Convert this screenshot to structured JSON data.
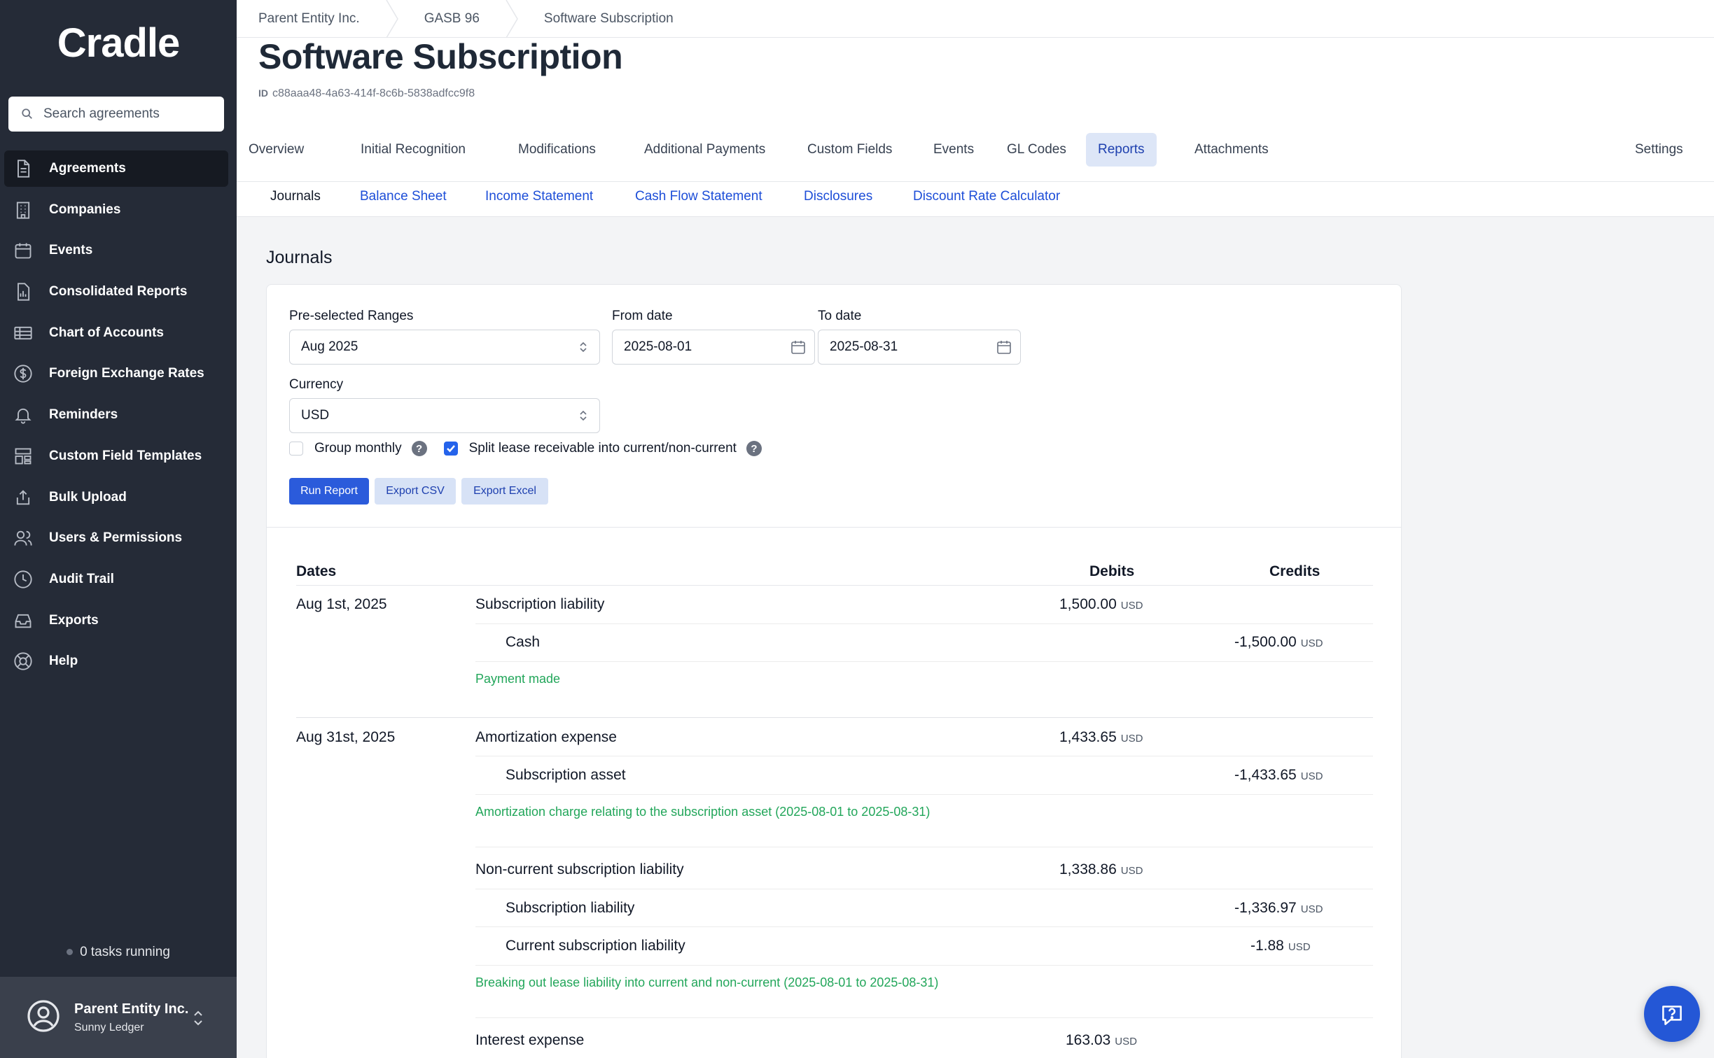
{
  "app": {
    "logo": "Cradle"
  },
  "sidebar": {
    "search_placeholder": "Search agreements",
    "items": [
      {
        "label": "Agreements",
        "icon": "document-icon",
        "active": true
      },
      {
        "label": "Companies",
        "icon": "building-icon"
      },
      {
        "label": "Events",
        "icon": "calendar-icon"
      },
      {
        "label": "Consolidated Reports",
        "icon": "report-icon"
      },
      {
        "label": "Chart of Accounts",
        "icon": "table-icon"
      },
      {
        "label": "Foreign Exchange Rates",
        "icon": "dollar-circle-icon"
      },
      {
        "label": "Reminders",
        "icon": "bell-icon"
      },
      {
        "label": "Custom Field Templates",
        "icon": "template-icon"
      },
      {
        "label": "Bulk Upload",
        "icon": "upload-icon"
      },
      {
        "label": "Users & Permissions",
        "icon": "users-icon"
      },
      {
        "label": "Audit Trail",
        "icon": "clock-icon"
      },
      {
        "label": "Exports",
        "icon": "tray-icon"
      },
      {
        "label": "Help",
        "icon": "lifebuoy-icon"
      }
    ],
    "tasks_status": "0 tasks running",
    "account": {
      "name": "Parent Entity Inc.",
      "subtitle": "Sunny Ledger"
    }
  },
  "breadcrumb": [
    "Parent Entity Inc.",
    "GASB 96",
    "Software Subscription"
  ],
  "page": {
    "title": "Software Subscription",
    "id_label": "ID",
    "id_value": "c88aaa48-4a63-414f-8c6b-5838adfcc9f8"
  },
  "tabs": [
    "Overview",
    "Initial Recognition",
    "Modifications",
    "Additional Payments",
    "Custom Fields",
    "Events",
    "GL Codes",
    "Reports",
    "Attachments"
  ],
  "active_tab": "Reports",
  "settings_label": "Settings",
  "subtabs": [
    "Journals",
    "Balance Sheet",
    "Income Statement",
    "Cash Flow Statement",
    "Disclosures",
    "Discount Rate Calculator"
  ],
  "active_subtab": "Journals",
  "section_title": "Journals",
  "form": {
    "range_label": "Pre-selected Ranges",
    "range_value": "Aug 2025",
    "from_label": "From date",
    "from_value": "2025-08-01",
    "to_label": "To date",
    "to_value": "2025-08-31",
    "currency_label": "Currency",
    "currency_value": "USD",
    "group_monthly_label": "Group monthly",
    "group_monthly_checked": false,
    "split_label": "Split lease receivable into current/non-current",
    "split_checked": true,
    "run_label": "Run Report",
    "export_csv_label": "Export CSV",
    "export_excel_label": "Export Excel"
  },
  "table": {
    "headers": {
      "dates": "Dates",
      "debits": "Debits",
      "credits": "Credits"
    },
    "currency": "USD",
    "row1": {
      "date": "Aug 1st, 2025",
      "line1": {
        "account": "Subscription liability",
        "debit": "1,500.00"
      },
      "line2": {
        "account": "Cash",
        "credit": "-1,500.00"
      },
      "desc": "Payment made"
    },
    "row2": {
      "date": "Aug 31st, 2025",
      "line1": {
        "account": "Amortization expense",
        "debit": "1,433.65"
      },
      "line2": {
        "account": "Subscription asset",
        "credit": "-1,433.65"
      },
      "desc": "Amortization charge relating to the subscription asset (2025-08-01 to 2025-08-31)",
      "line3": {
        "account": "Non-current subscription liability",
        "debit": "1,338.86"
      },
      "line4": {
        "account": "Subscription liability",
        "credit": "-1,336.97"
      },
      "line5": {
        "account": "Current subscription liability",
        "credit": "-1.88"
      },
      "desc2": "Breaking out lease liability into current and non-current (2025-08-01 to 2025-08-31)",
      "line6": {
        "account": "Interest expense",
        "debit": "163.03"
      }
    }
  },
  "colors": {
    "sidebar": "#252b37",
    "accent": "#2b5bdb",
    "desc_green": "#22a65a"
  }
}
